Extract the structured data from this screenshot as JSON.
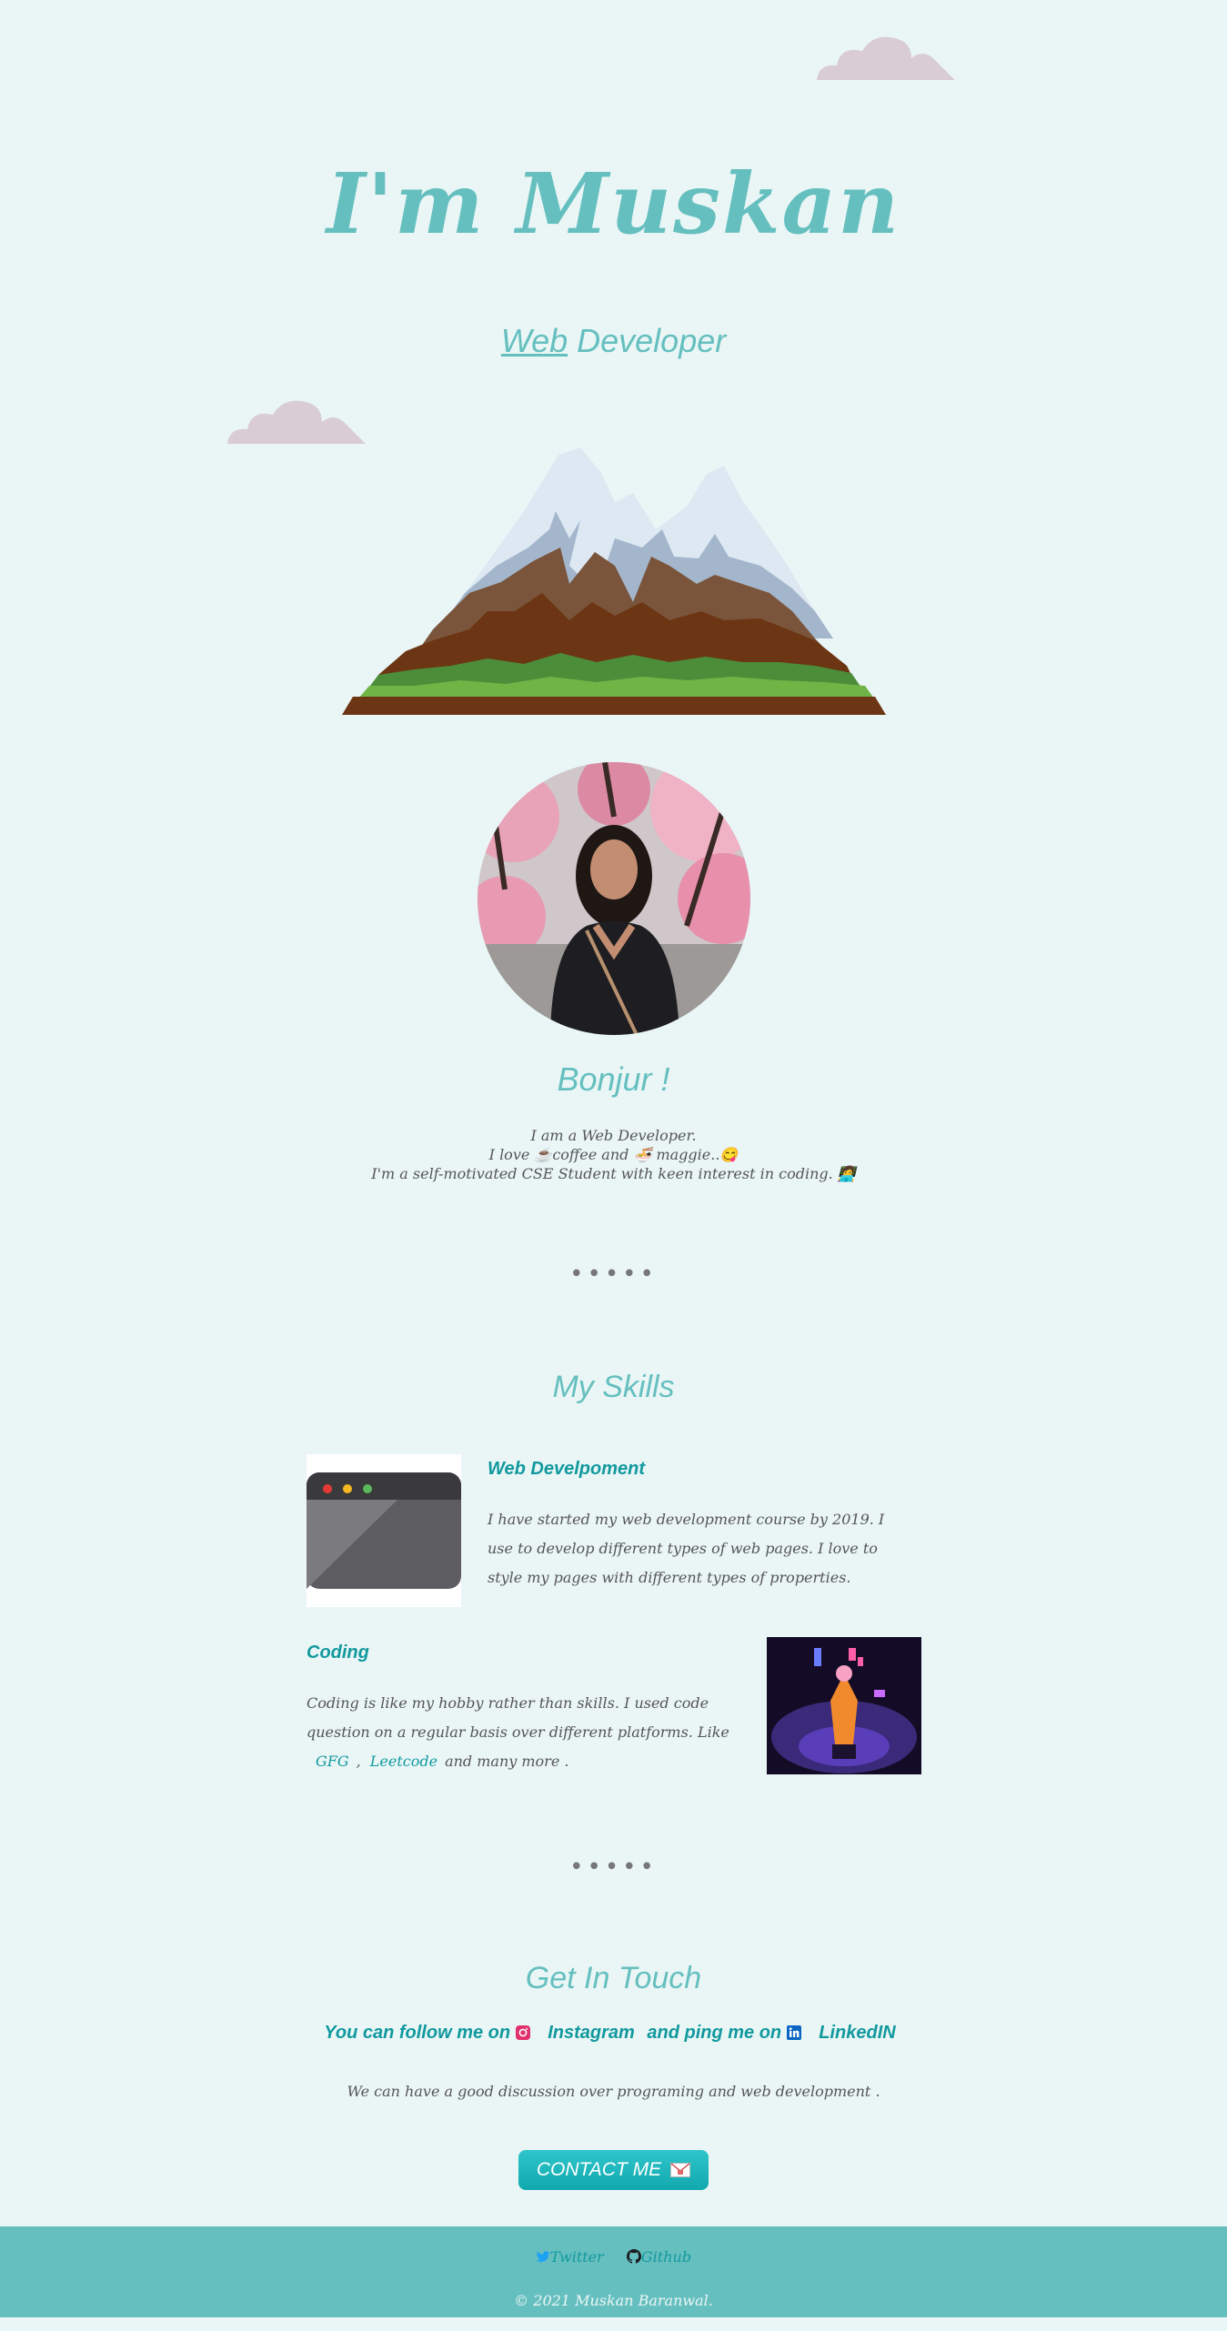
{
  "header": {
    "title": "I'm Muskan",
    "subtitle_link": "Web",
    "subtitle_rest": " Developer"
  },
  "profile": {
    "greeting": "Bonjur !",
    "line1": "I am a Web Developer.",
    "line2_prefix": "I love ",
    "line2_coffee": "coffee and ",
    "line2_maggie": " maggie..",
    "line3": "I'm a self-motivated CSE Student with keen interest in coding. "
  },
  "divider": "•••••",
  "skills": {
    "title": "My Skills",
    "web": {
      "heading": "Web Develpoment",
      "text": "I have started my web development course by 2019. I use to develop different types of web pages. I love to style my pages with different types of properties."
    },
    "coding": {
      "heading": "Coding",
      "text": "Coding is like my hobby rather than skills. I used code question on a regular basis over different platforms. Like",
      "link1": "GFG",
      "separator": ",",
      "link2": "Leetcode",
      "suffix": "and many more ."
    }
  },
  "contact": {
    "title": "Get In Touch",
    "follow_prefix": "You can follow me on",
    "instagram": "Instagram",
    "ping_prefix": "and ping me on",
    "linkedin": "LinkedIN",
    "discussion": "We can have a good discussion over programing and web development .",
    "button_label": "CONTACT ME"
  },
  "footer": {
    "twitter": "Twitter",
    "github": "Github",
    "copyright": "© 2021 Muskan Baranwal."
  },
  "colors": {
    "background": "#eaf6f6",
    "accent": "#66bfbf",
    "accent_dark": "#11999e",
    "cloud": "#d9cdd3"
  }
}
